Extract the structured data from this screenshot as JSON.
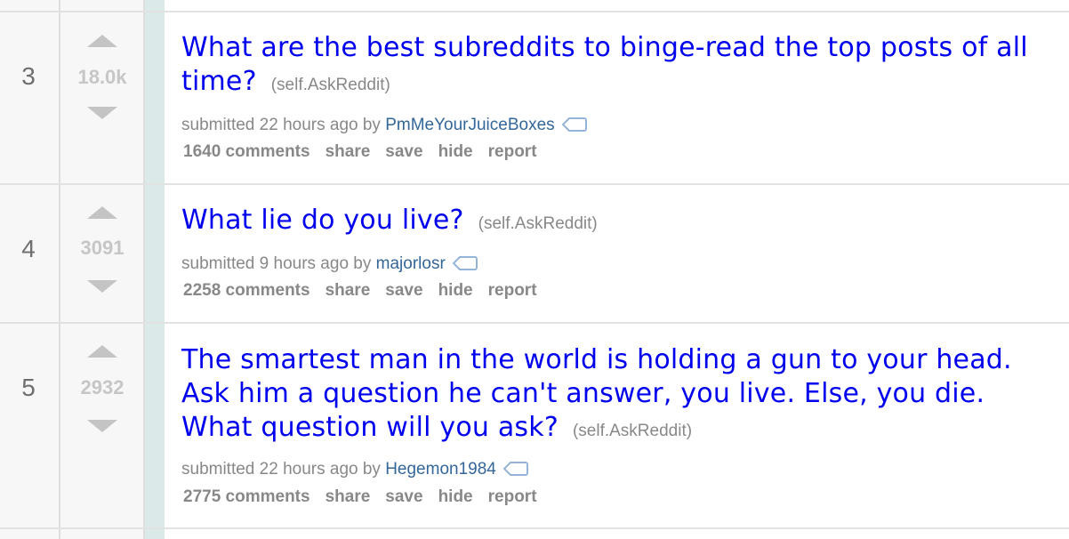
{
  "colors": {
    "title_link": "#0000ee",
    "author_link": "#336699",
    "muted_text": "#888888",
    "vote_arrow": "#c4c4c4",
    "score": "#c6c6c6",
    "thing_stripe": "#dce9e9"
  },
  "posts": [
    {
      "rank": "3",
      "score": "18.0k",
      "title": "What are the best subreddits to binge-read the top posts of all time?",
      "domain": "(self.AskReddit)",
      "submitted_prefix": "submitted 22 hours ago by",
      "author": "PmMeYourJuiceBoxes",
      "comments": "1640 comments",
      "share": "share",
      "save": "save",
      "hide": "hide",
      "report": "report"
    },
    {
      "rank": "4",
      "score": "3091",
      "title": "What lie do you live?",
      "domain": "(self.AskReddit)",
      "submitted_prefix": "submitted 9 hours ago by",
      "author": "majorlosr",
      "comments": "2258 comments",
      "share": "share",
      "save": "save",
      "hide": "hide",
      "report": "report"
    },
    {
      "rank": "5",
      "score": "2932",
      "title": "The smartest man in the world is holding a gun to your head. Ask him a question he can't answer, you live. Else, you die. What question will you ask?",
      "domain": "(self.AskReddit)",
      "submitted_prefix": "submitted 22 hours ago by",
      "author": "Hegemon1984",
      "comments": "2775 comments",
      "share": "share",
      "save": "save",
      "hide": "hide",
      "report": "report"
    }
  ]
}
